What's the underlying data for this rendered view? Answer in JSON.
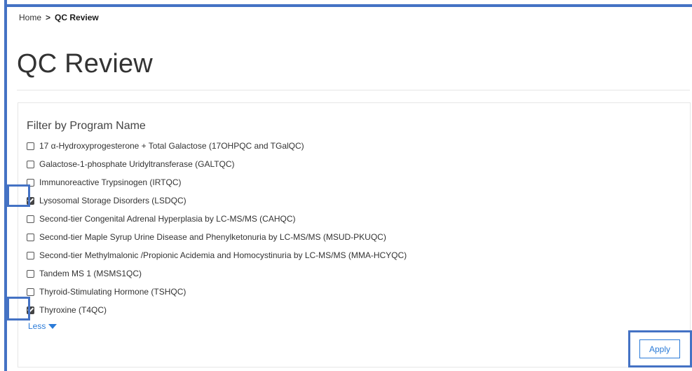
{
  "breadcrumb": {
    "home": "Home",
    "separator": ">",
    "current": "QC Review"
  },
  "page": {
    "title": "QC Review"
  },
  "filter": {
    "heading": "Filter by Program Name",
    "options": [
      {
        "label": "17 α-Hydroxyprogesterone + Total Galactose (17OHPQC and TGalQC)",
        "checked": false
      },
      {
        "label": "Galactose-1-phosphate Uridyltransferase (GALTQC)",
        "checked": false
      },
      {
        "label": "Immunoreactive Trypsinogen (IRTQC)",
        "checked": false
      },
      {
        "label": "Lysosomal Storage Disorders (LSDQC)",
        "checked": true
      },
      {
        "label": "Second-tier Congenital Adrenal Hyperplasia by LC-MS/MS (CAHQC)",
        "checked": false
      },
      {
        "label": "Second-tier Maple Syrup Urine Disease and Phenylketonuria by LC-MS/MS (MSUD-PKUQC)",
        "checked": false
      },
      {
        "label": "Second-tier Methylmalonic /Propionic Acidemia and Homocystinuria by LC-MS/MS (MMA-HCYQC)",
        "checked": false
      },
      {
        "label": "Tandem MS 1 (MSMS1QC)",
        "checked": false
      },
      {
        "label": "Thyroid-Stimulating Hormone (TSHQC)",
        "checked": false
      },
      {
        "label": "Thyroxine (T4QC)",
        "checked": true
      }
    ],
    "less_label": "Less",
    "apply_label": "Apply"
  },
  "colors": {
    "accent": "#2b7bd8",
    "annotation": "#4472c4"
  }
}
